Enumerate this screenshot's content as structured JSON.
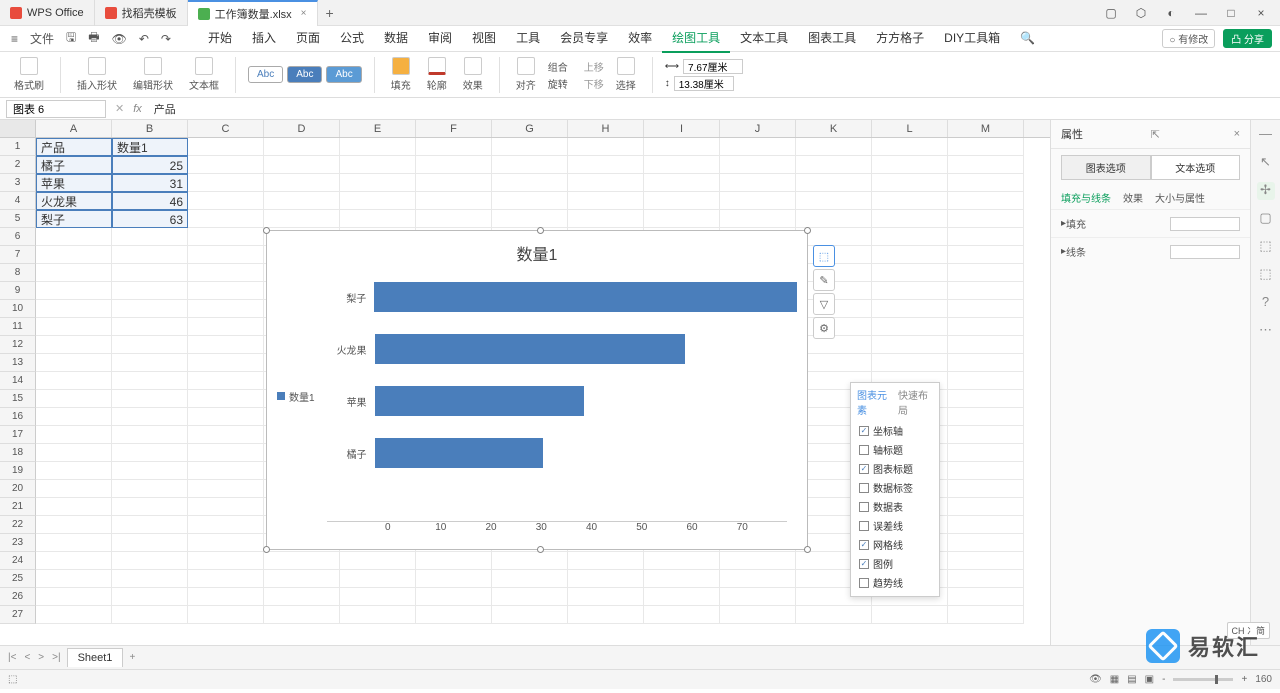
{
  "titlebar": {
    "app": "WPS Office",
    "tab1": "找稻壳模板",
    "tab2": "工作簿数量.xlsx"
  },
  "menubar": {
    "file": "文件",
    "right_modify": "有修改",
    "right_share": "分享"
  },
  "main_tabs": [
    "开始",
    "插入",
    "页面",
    "公式",
    "数据",
    "审阅",
    "视图",
    "工具",
    "会员专享",
    "效率",
    "绘图工具",
    "文本工具",
    "图表工具",
    "方方格子",
    "DIY工具箱"
  ],
  "main_tab_active": 10,
  "ribbon": {
    "format_painter": "格式刷",
    "insert_shape": "插入形状",
    "edit_shape": "编辑形状",
    "textbox": "文本框",
    "abc": "Abc",
    "fill": "填充",
    "outline": "轮廓",
    "effect": "效果",
    "align": "对齐",
    "group": "组合",
    "rotate": "旋转",
    "up": "上移",
    "down": "下移",
    "select": "选择",
    "width": "7.67厘米",
    "height": "13.38厘米"
  },
  "formula": {
    "name": "图表 6",
    "value": "产品"
  },
  "columns": [
    "A",
    "B",
    "C",
    "D",
    "E",
    "F",
    "G",
    "H",
    "I",
    "J",
    "K",
    "L",
    "M"
  ],
  "table": {
    "header": [
      "产品",
      "数量1"
    ],
    "rows": [
      [
        "橘子",
        "25"
      ],
      [
        "苹果",
        "31"
      ],
      [
        "火龙果",
        "46"
      ],
      [
        "梨子",
        "63"
      ]
    ]
  },
  "chart_data": {
    "type": "bar",
    "title": "数量1",
    "legend": "数量1",
    "categories": [
      "梨子",
      "火龙果",
      "苹果",
      "橘子"
    ],
    "values": [
      63,
      46,
      31,
      25
    ],
    "xlim": [
      0,
      70
    ],
    "xticks": [
      0,
      10,
      20,
      30,
      40,
      50,
      60,
      70
    ]
  },
  "popup": {
    "tab1": "图表元素",
    "tab2": "快速布局",
    "items": [
      {
        "label": "坐标轴",
        "checked": true
      },
      {
        "label": "轴标题",
        "checked": false
      },
      {
        "label": "图表标题",
        "checked": true
      },
      {
        "label": "数据标签",
        "checked": false
      },
      {
        "label": "数据表",
        "checked": false
      },
      {
        "label": "误差线",
        "checked": false
      },
      {
        "label": "网格线",
        "checked": true
      },
      {
        "label": "图例",
        "checked": true
      },
      {
        "label": "趋势线",
        "checked": false
      }
    ]
  },
  "right_panel": {
    "title": "属性",
    "tab1": "图表选项",
    "tab2": "文本选项",
    "sub": [
      "填充与线条",
      "效果",
      "大小与属性"
    ],
    "sec1": "填充",
    "sec2": "线条"
  },
  "sheet": {
    "name": "Sheet1"
  },
  "status": {
    "zoom": "160",
    "ime": "CH 冫简"
  },
  "watermark": "易软汇"
}
